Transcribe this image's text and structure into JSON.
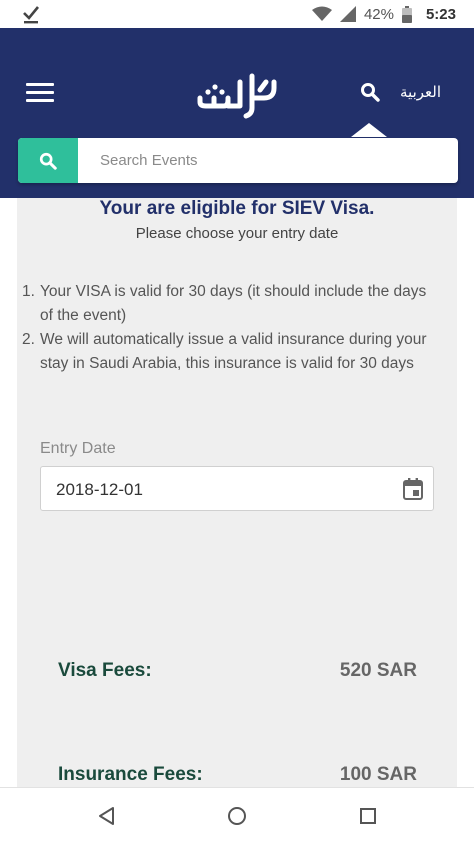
{
  "status_bar": {
    "battery": "42%",
    "time": "5:23",
    "icons": [
      "check-icon",
      "wifi-icon",
      "signal-icon",
      "battery-icon"
    ]
  },
  "header": {
    "language": "العربية",
    "icons": [
      "menu-icon",
      "search-icon"
    ]
  },
  "search": {
    "placeholder": "Search Events"
  },
  "main": {
    "title": "Your are eligible for SIEV Visa.",
    "subtitle": "Please choose your entry date",
    "notes": [
      {
        "num": "1.",
        "text": "Your VISA is valid for 30 days (it should include the days of the event)"
      },
      {
        "num": "2.",
        "text": "We will automatically issue a valid insurance during your stay in Saudi Arabia, this insurance is valid for 30 days"
      }
    ],
    "entry_date": {
      "label": "Entry Date",
      "value": "2018-12-01"
    },
    "fees": [
      {
        "label": "Visa Fees:",
        "value": "520 SAR"
      },
      {
        "label": "Insurance Fees:",
        "value": "100 SAR"
      }
    ]
  },
  "colors": {
    "header_bg": "#22306a",
    "accent": "#2fbf9b",
    "title": "#22306a",
    "fee_label": "#1a4a3c"
  }
}
